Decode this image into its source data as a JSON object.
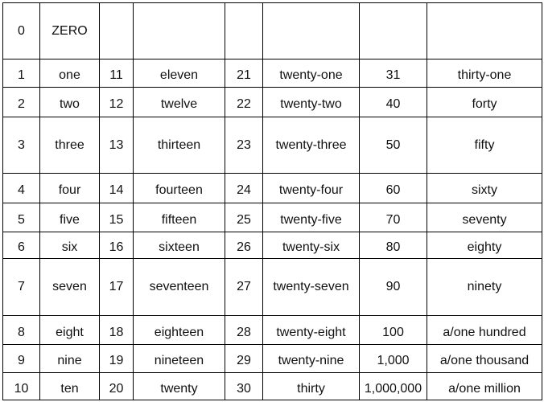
{
  "table": {
    "rows": [
      [
        "0",
        "ZERO",
        "",
        "",
        "",
        "",
        "",
        ""
      ],
      [
        "1",
        "one",
        "11",
        "eleven",
        "21",
        "twenty-one",
        "31",
        "thirty-one"
      ],
      [
        "2",
        "two",
        "12",
        "twelve",
        "22",
        "twenty-two",
        "40",
        "forty"
      ],
      [
        "3",
        "three",
        "13",
        "thirteen",
        "23",
        "twenty-three",
        "50",
        "fifty"
      ],
      [
        "4",
        "four",
        "14",
        "fourteen",
        "24",
        "twenty-four",
        "60",
        "sixty"
      ],
      [
        "5",
        "five",
        "15",
        "fifteen",
        "25",
        "twenty-five",
        "70",
        "seventy"
      ],
      [
        "6",
        "six",
        "16",
        "sixteen",
        "26",
        "twenty-six",
        "80",
        "eighty"
      ],
      [
        "7",
        "seven",
        "17",
        "seventeen",
        "27",
        "twenty-seven",
        "90",
        "ninety"
      ],
      [
        "8",
        "eight",
        "18",
        "eighteen",
        "28",
        "twenty-eight",
        "100",
        "a/one hundred"
      ],
      [
        "9",
        "nine",
        "19",
        "nineteen",
        "29",
        "twenty-nine",
        "1,000",
        "a/one thousand"
      ],
      [
        "10",
        "ten",
        "20",
        "twenty",
        "30",
        "thirty",
        "1,000,000",
        "a/one million"
      ]
    ]
  }
}
